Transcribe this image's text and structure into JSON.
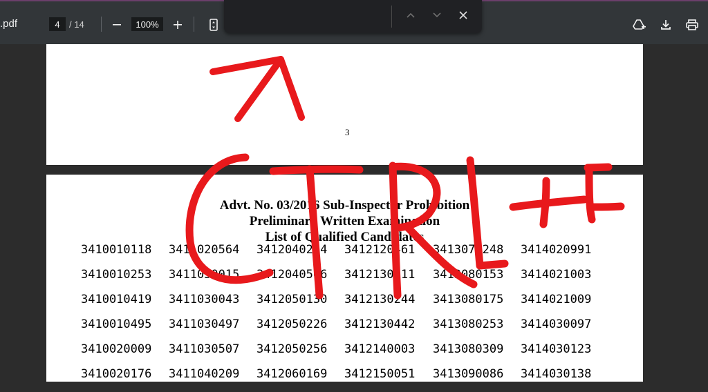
{
  "toolbar": {
    "filename": ".pdf",
    "current_page": "4",
    "total_pages": "/ 14",
    "zoom": "100%"
  },
  "find_bar": {
    "query": ""
  },
  "document": {
    "page_number": "3",
    "heading_line1": "Advt. No. 03/2016 Sub-Inspector Prohibition",
    "heading_line2": "Preliminary Written Examination",
    "heading_line3": "List of Qualified Candidates",
    "rows": [
      [
        "3410010118",
        "3411020564",
        "3412040224",
        "3412120461",
        "3413070248",
        "3414020991"
      ],
      [
        "3410010253",
        "3411030015",
        "3412040506",
        "3412130011",
        "3413080153",
        "3414021003"
      ],
      [
        "3410010419",
        "3411030043",
        "3412050130",
        "3412130244",
        "3413080175",
        "3414021009"
      ],
      [
        "3410010495",
        "3411030497",
        "3412050226",
        "3412130442",
        "3413080253",
        "3414030097"
      ],
      [
        "3410020009",
        "3411030507",
        "3412050256",
        "3412140003",
        "3413080309",
        "3414030123"
      ],
      [
        "3410020176",
        "3411040209",
        "3412060169",
        "3412150051",
        "3413090086",
        "3414030138"
      ]
    ]
  },
  "annotation": {
    "text": "CTRL+F",
    "color": "#e8191c"
  }
}
